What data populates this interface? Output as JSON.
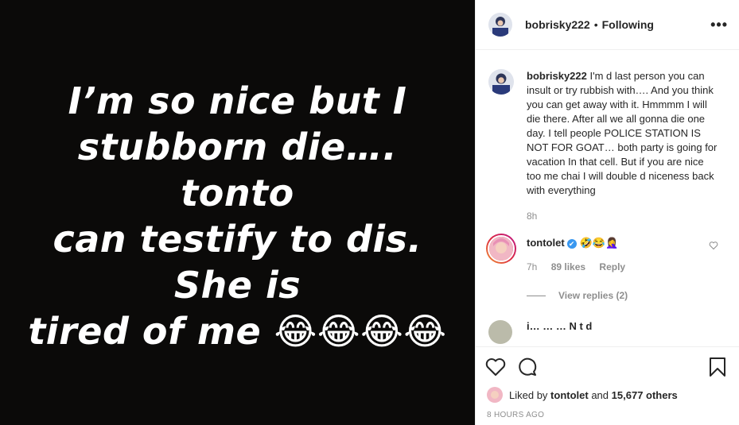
{
  "media": {
    "lines": [
      "I’m so nice but I",
      "stubborn die…. tonto",
      "can testify to dis. She is",
      "tired of me 😂😂😂😂"
    ]
  },
  "header": {
    "username": "bobrisky222",
    "separator": "•",
    "follow_status": "Following",
    "more": "•••"
  },
  "caption": {
    "username": "bobrisky222",
    "text": "I'm d last person you can insult or try rubbish with…. And you think you can get away with it. Hmmmm I will die there. After all we all gonna die one day. I tell people POLICE STATION IS NOT FOR GOAT… both party is going for vacation In that cell. But if you are nice too me chai I will double d niceness back with everything",
    "time": "8h"
  },
  "comment": {
    "username": "tontolet",
    "verified": "✔",
    "emojis": "🤣😂🤦‍♀️",
    "time": "7h",
    "likes": "89 likes",
    "reply": "Reply",
    "view_replies": "View replies (2)"
  },
  "next_comment": {
    "text": "i… … … N t d"
  },
  "likes": {
    "prefix": "Liked by",
    "user": "tontolet",
    "middle": "and",
    "others": "15,677 others"
  },
  "timestamp": "8 HOURS AGO",
  "colors": {
    "media_bg": "#0b0a09",
    "verified": "#3897f0",
    "muted": "#8e8e8e"
  }
}
